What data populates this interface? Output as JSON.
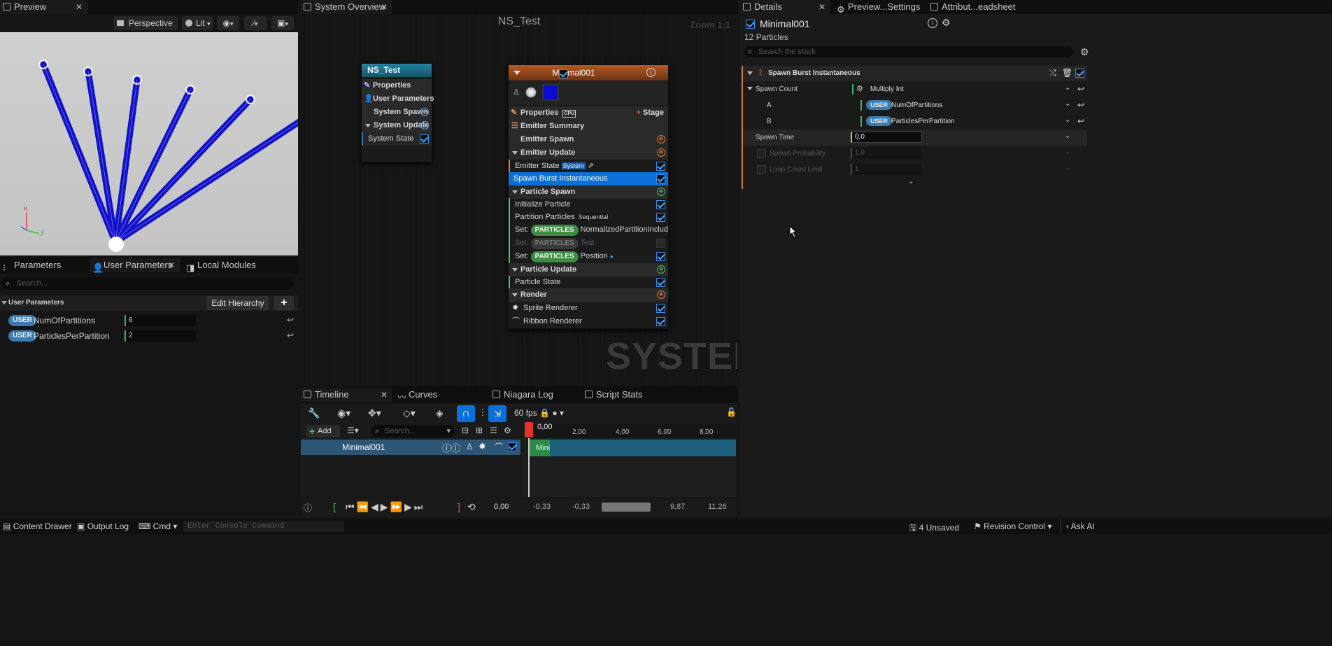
{
  "preview": {
    "tab": "Preview",
    "perspective": "Perspective",
    "lit": "Lit",
    "axis_x": "x",
    "axis_y": "y"
  },
  "param_tabs": {
    "parameters": "Parameters",
    "user_parameters": "User Parameters",
    "local_modules": "Local Modules"
  },
  "param_panel": {
    "search_placeholder": "Search...",
    "section": "User Parameters",
    "edit_hierarchy": "Edit Hierarchy",
    "rows": [
      {
        "tag": "USER",
        "name": "NumOfPartitions",
        "value": "6"
      },
      {
        "tag": "USER",
        "name": "ParticlesPerPartition",
        "value": "2"
      }
    ]
  },
  "overview": {
    "tab": "System Overview",
    "title": "NS_Test",
    "zoom": "Zoom 1:1",
    "watermark": "SYSTEM"
  },
  "system_node": {
    "title": "NS_Test",
    "properties": "Properties",
    "user_parameters": "User Parameters",
    "system_spawn": "System Spawn",
    "system_update": "System Update",
    "system_state": "System State"
  },
  "emitter_node": {
    "title": "Minimal001",
    "properties": "Properties",
    "cpu": "CPU",
    "stage": "Stage",
    "emitter_summary": "Emitter Summary",
    "emitter_spawn": "Emitter Spawn",
    "emitter_update": "Emitter Update",
    "emitter_state": "Emitter State",
    "emitter_state_tag": "System",
    "spawn_burst": "Spawn Burst Instantaneous",
    "particle_spawn": "Particle Spawn",
    "initialize_particle": "Initialize Particle",
    "partition_particles": "Partition Particles",
    "partition_tag": "Sequential",
    "set1_prefix": "Set:",
    "set1_tag": "PARTICLES",
    "set1_name": "NormalizedPartitionIncludingOne",
    "set2_prefix": "Set:",
    "set2_tag": "PARTICLES",
    "set2_name": "Test",
    "set3_prefix": "Set:",
    "set3_tag": "PARTICLES",
    "set3_name": "Position",
    "particle_update": "Particle Update",
    "particle_state": "Particle State",
    "render": "Render",
    "sprite_renderer": "Sprite Renderer",
    "ribbon_renderer": "Ribbon Renderer"
  },
  "details": {
    "tabs": [
      "Details",
      "Preview...Settings",
      "Attribut...eadsheet"
    ],
    "name": "Minimal001",
    "subtitle": "12 Particles",
    "search_placeholder": "Search the stack",
    "module": "Spawn Burst Instantaneous",
    "rows": [
      {
        "label": "Spawn Count",
        "value": "Multiply Int"
      },
      {
        "label": "A",
        "tag": "USER",
        "value": "NumOfPartitions"
      },
      {
        "label": "B",
        "tag": "USER",
        "value": "ParticlesPerPartition"
      },
      {
        "label": "Spawn Time",
        "value": "0,0"
      },
      {
        "label": "Spawn Probability",
        "value": "1,0"
      },
      {
        "label": "Loop Count Limit",
        "value": "1"
      }
    ]
  },
  "timeline": {
    "tabs": [
      "Timeline",
      "Curves",
      "Niagara Log",
      "Script Stats"
    ],
    "fps": "60 fps",
    "add": "Add",
    "search_placeholder": "Search...",
    "playhead": "0,00",
    "ruler": [
      "2,00",
      "4,00",
      "6,00",
      "8,00"
    ],
    "track": "Minimal001",
    "track_bar": "Mini",
    "time_current": "0,00",
    "range_start": "-0,33",
    "range_start2": "-0,33",
    "range_end": "9,87",
    "range_end2": "11,26"
  },
  "statusbar": {
    "content_drawer": "Content Drawer",
    "output_log": "Output Log",
    "cmd": "Cmd",
    "console_placeholder": "Enter Console Command",
    "unsaved": "4 Unsaved",
    "revision": "Revision Control",
    "ask_ai": "Ask AI"
  },
  "colors": {
    "accent_blue": "#0a70d8",
    "emitter_header": "#9a4a1e",
    "system_header": "#1d6f86",
    "track_bar": "#1b5f7c",
    "track_green": "#2e8b47",
    "playhead_red": "#e03030"
  }
}
